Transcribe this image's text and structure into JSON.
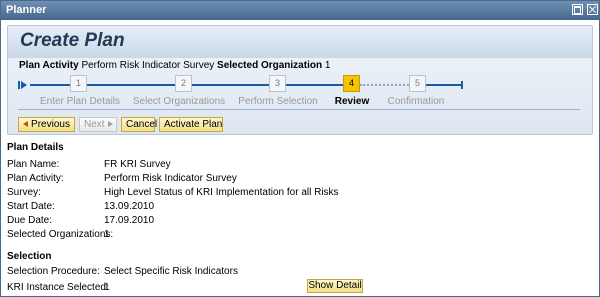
{
  "window": {
    "title": "Planner"
  },
  "page": {
    "title": "Create Plan"
  },
  "activity": {
    "label": "Plan Activity",
    "value": "Perform Risk Indicator Survey",
    "org_label": "Selected Organization",
    "org_value": "1"
  },
  "roadmap": {
    "steps": [
      {
        "num": "1",
        "label": "Enter Plan Details",
        "active": false
      },
      {
        "num": "2",
        "label": "Select Organizations",
        "active": false
      },
      {
        "num": "3",
        "label": "Perform Selection",
        "active": false
      },
      {
        "num": "4",
        "label": "Review",
        "active": true
      },
      {
        "num": "5",
        "label": "Confirmation",
        "active": false
      }
    ]
  },
  "toolbar": {
    "previous": "Previous",
    "next": "Next",
    "cancel": "Cancel",
    "activate": "Activate Plan"
  },
  "details": {
    "heading": "Plan Details",
    "rows": [
      {
        "label": "Plan Name:",
        "value": "FR KRI Survey"
      },
      {
        "label": "Plan Activity:",
        "value": "Perform Risk Indicator Survey"
      },
      {
        "label": "Survey:",
        "value": "High Level Status of KRI Implementation for all Risks"
      },
      {
        "label": "Start Date:",
        "value": "13.09.2010"
      },
      {
        "label": "Due Date:",
        "value": "17.09.2010"
      },
      {
        "label": "Selected Organizations:",
        "value": "1"
      }
    ]
  },
  "selection": {
    "heading": "Selection",
    "rows": [
      {
        "label": "Selection Procedure:",
        "value": "Select Specific Risk Indicators"
      },
      {
        "label": "KRI Instance Selected:",
        "value": "1"
      }
    ],
    "show_detail": "Show Detail"
  },
  "icons": {
    "maximize": "maximize-icon",
    "close": "close-icon"
  }
}
